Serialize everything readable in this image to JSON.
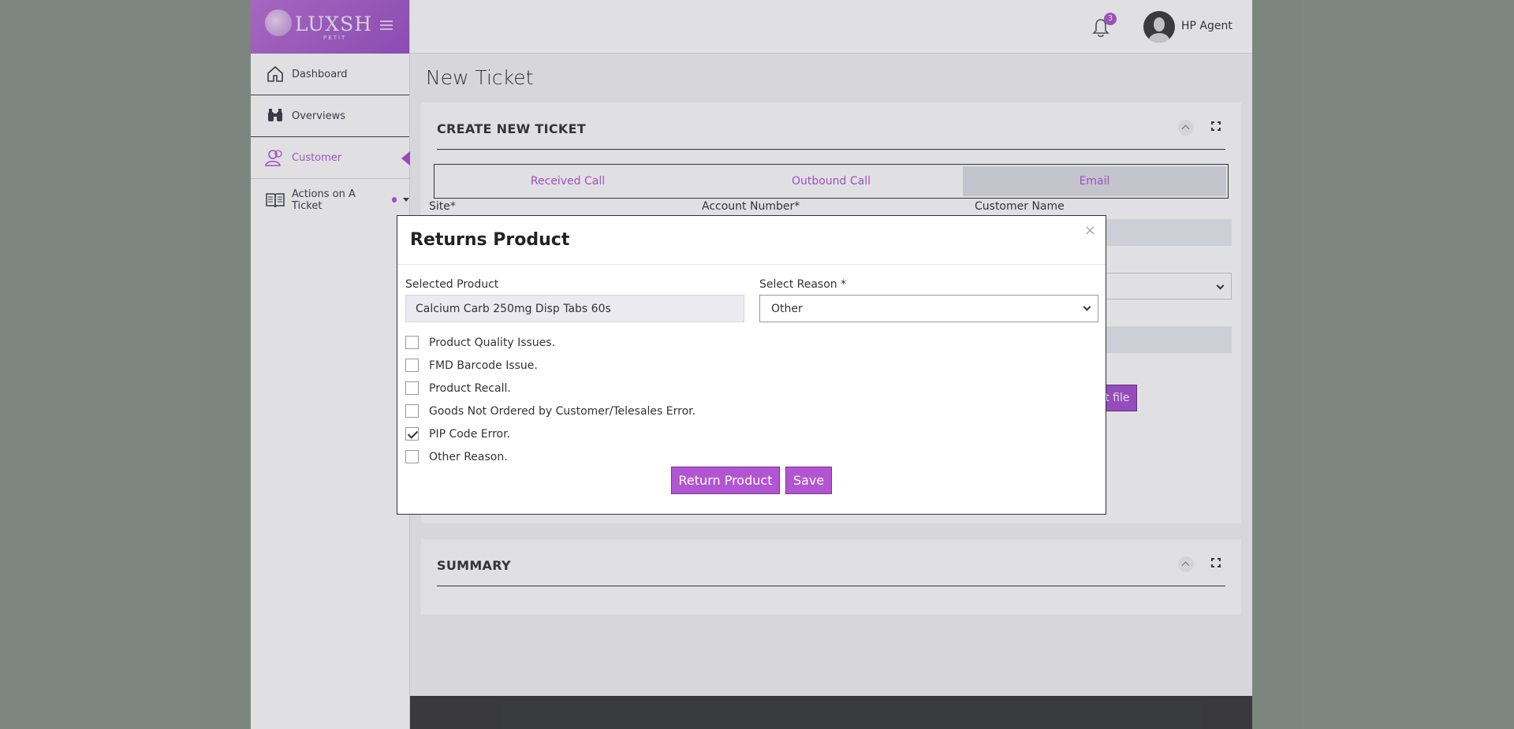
{
  "brand": {
    "logo_text": "LUXSH",
    "logo_sub": "PETIT"
  },
  "sidebar": {
    "items": [
      {
        "label": "Dashboard"
      },
      {
        "label": "Overviews"
      },
      {
        "label": "Customer"
      },
      {
        "label": "Actions on A Ticket"
      }
    ]
  },
  "topbar": {
    "notification_count": "3",
    "user_name": "HP Agent"
  },
  "page": {
    "title": "New Ticket",
    "card_title": "CREATE NEW TICKET",
    "call_tabs": [
      "Received Call",
      "Outbound Call",
      "Email"
    ],
    "fields": {
      "site": "Site*",
      "account_number": "Account Number*",
      "customer_name": "Customer Name"
    },
    "select_file": "Select file",
    "summary_title": "SUMMARY"
  },
  "modal": {
    "title": "Returns Product",
    "close": "×",
    "selected_product_label": "Selected Product",
    "selected_product_value": "Calcium Carb 250mg Disp Tabs 60s",
    "select_reason_label": "Select Reason *",
    "select_reason_value": "Other",
    "checkboxes": [
      {
        "label": "Product Quality Issues.",
        "checked": false
      },
      {
        "label": "FMD Barcode Issue.",
        "checked": false
      },
      {
        "label": "Product Recall.",
        "checked": false
      },
      {
        "label": "Goods Not Ordered by Customer/Telesales Error.",
        "checked": false
      },
      {
        "label": "PIP Code Error.",
        "checked": true
      },
      {
        "label": "Other Reason.",
        "checked": false
      }
    ],
    "return_button": "Return Product",
    "save_button": "Save"
  },
  "colors": {
    "accent": "#b155d2",
    "brand_gradient_start": "#b96fd4",
    "footer": "#3a3a3a"
  }
}
